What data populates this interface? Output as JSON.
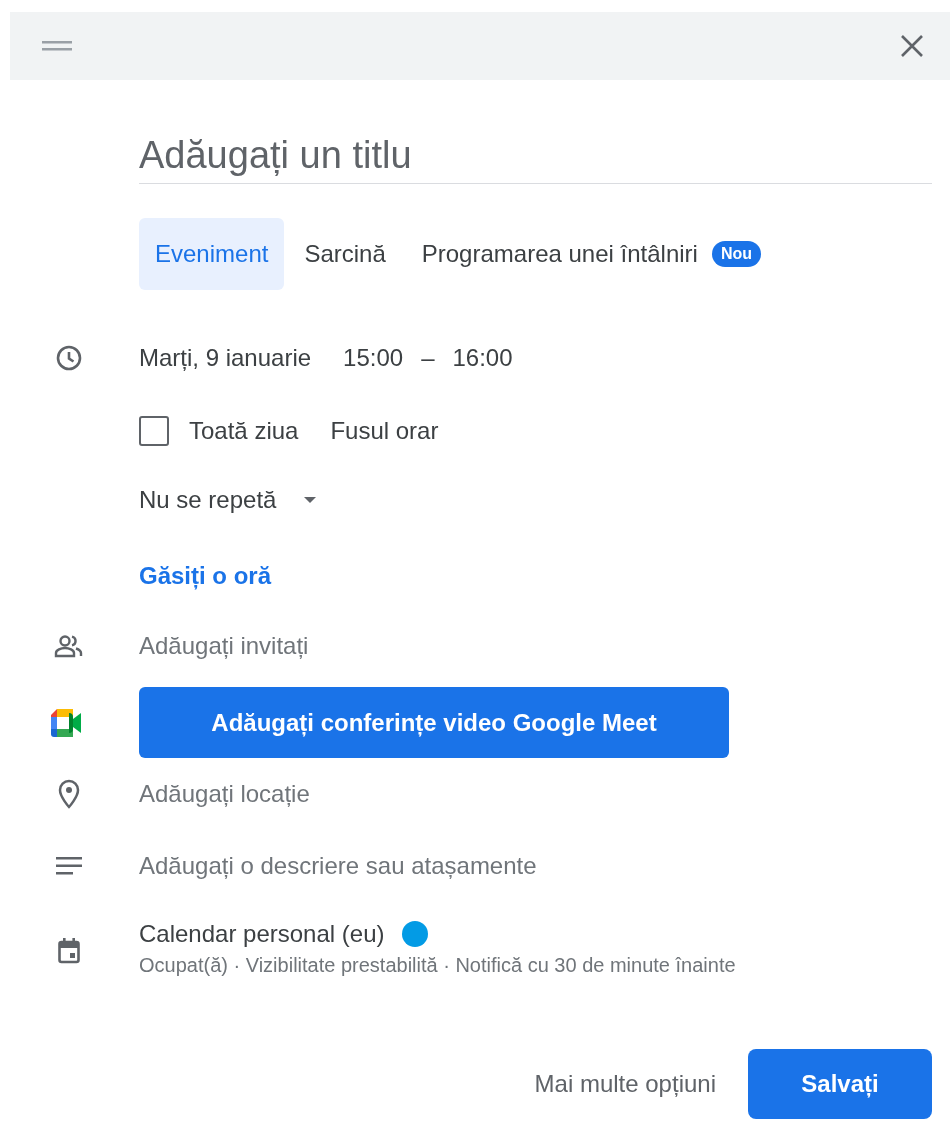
{
  "title": {
    "placeholder": "Adăugați un titlu"
  },
  "tabs": [
    {
      "label": "Eveniment",
      "selected": true
    },
    {
      "label": "Sarcină",
      "selected": false
    },
    {
      "label": "Programarea unei întâlniri",
      "selected": false,
      "badge": "Nou"
    }
  ],
  "when": {
    "date": "Marți, 9 ianuarie",
    "start": "15:00",
    "separator": "–",
    "end": "16:00"
  },
  "all_day": {
    "label": "Toată ziua",
    "checked": false
  },
  "timezone": "Fusul orar",
  "repeat": "Nu se repetă",
  "find_time": "Găsiți o oră",
  "rows": [
    {
      "kind": "guests",
      "placeholder": "Adăugați invitați"
    },
    {
      "kind": "meet",
      "label": "Adăugați conferințe video Google Meet"
    },
    {
      "kind": "location",
      "placeholder": "Adăugați locație"
    },
    {
      "kind": "description",
      "placeholder": "Adăugați o descriere sau atașamente"
    }
  ],
  "calendar": {
    "name": "Calendar personal (eu)",
    "color": "#039be5",
    "details": "Ocupat(ă) · Vizibilitate prestabilită · Notifică cu 30 de minute înainte"
  },
  "footer": {
    "more_options": "Mai multe opțiuni",
    "save": "Salvați"
  }
}
